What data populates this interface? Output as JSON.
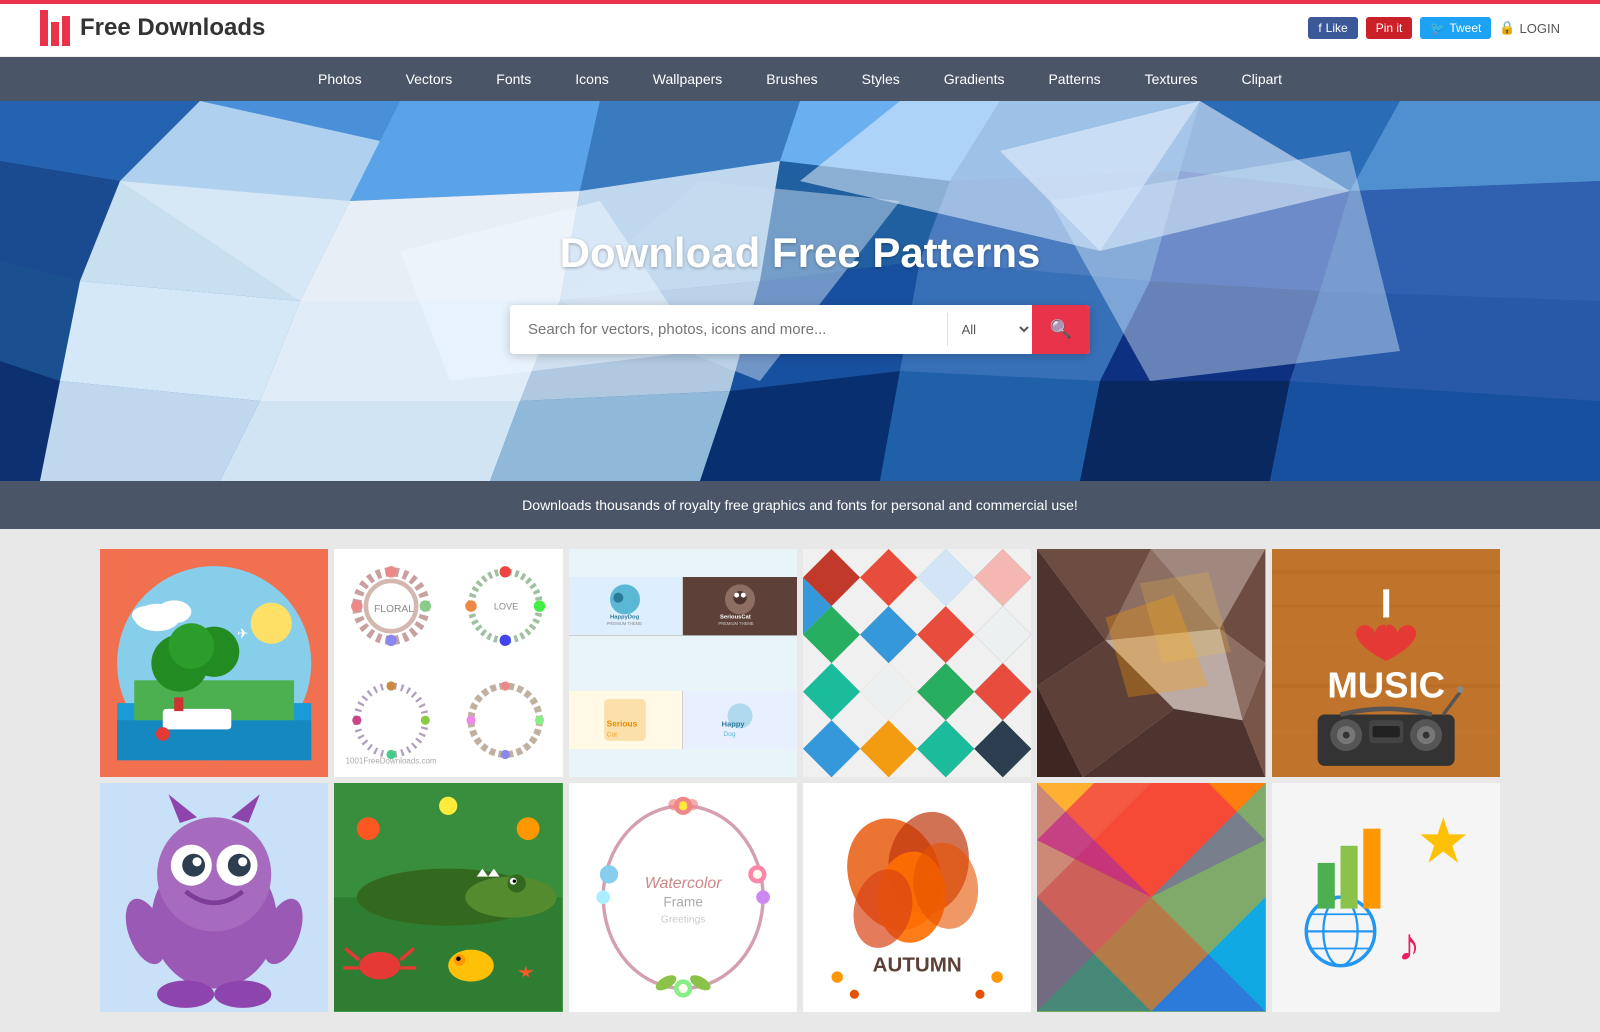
{
  "header": {
    "logo_text": "Free Downloads",
    "top_bar_color": "#e8334a",
    "fb_label": "Like",
    "pin_label": "Pin it",
    "tweet_label": "Tweet",
    "login_label": "LOGIN"
  },
  "nav": {
    "items": [
      {
        "label": "Photos",
        "href": "#"
      },
      {
        "label": "Vectors",
        "href": "#"
      },
      {
        "label": "Fonts",
        "href": "#"
      },
      {
        "label": "Icons",
        "href": "#"
      },
      {
        "label": "Wallpapers",
        "href": "#"
      },
      {
        "label": "Brushes",
        "href": "#"
      },
      {
        "label": "Styles",
        "href": "#"
      },
      {
        "label": "Gradients",
        "href": "#"
      },
      {
        "label": "Patterns",
        "href": "#"
      },
      {
        "label": "Textures",
        "href": "#"
      },
      {
        "label": "Clipart",
        "href": "#"
      }
    ]
  },
  "hero": {
    "title": "Download Free Patterns",
    "search_placeholder": "Search for vectors, photos, icons and more...",
    "search_dropdown_default": "All",
    "search_btn_label": "🔍"
  },
  "tagline": {
    "text": "Downloads thousands of royalty free graphics and fonts for personal and commercial use!"
  },
  "gallery": {
    "items": [
      {
        "id": "beach",
        "alt": "Beach island illustration"
      },
      {
        "id": "floral",
        "alt": "Floral wreath collection"
      },
      {
        "id": "logo-pack",
        "alt": "Happy Dog Serious Cat logo pack"
      },
      {
        "id": "diamond",
        "alt": "Diamond pattern"
      },
      {
        "id": "lowpoly",
        "alt": "Low poly abstract background"
      },
      {
        "id": "music",
        "alt": "I Love Music poster"
      },
      {
        "id": "monster",
        "alt": "Monster character"
      },
      {
        "id": "animals",
        "alt": "Animals illustration"
      },
      {
        "id": "frame",
        "alt": "Watercolor frame"
      },
      {
        "id": "autumn",
        "alt": "Autumn illustration"
      },
      {
        "id": "geometric",
        "alt": "Geometric colorful"
      },
      {
        "id": "web-icons",
        "alt": "Web icons"
      }
    ]
  }
}
